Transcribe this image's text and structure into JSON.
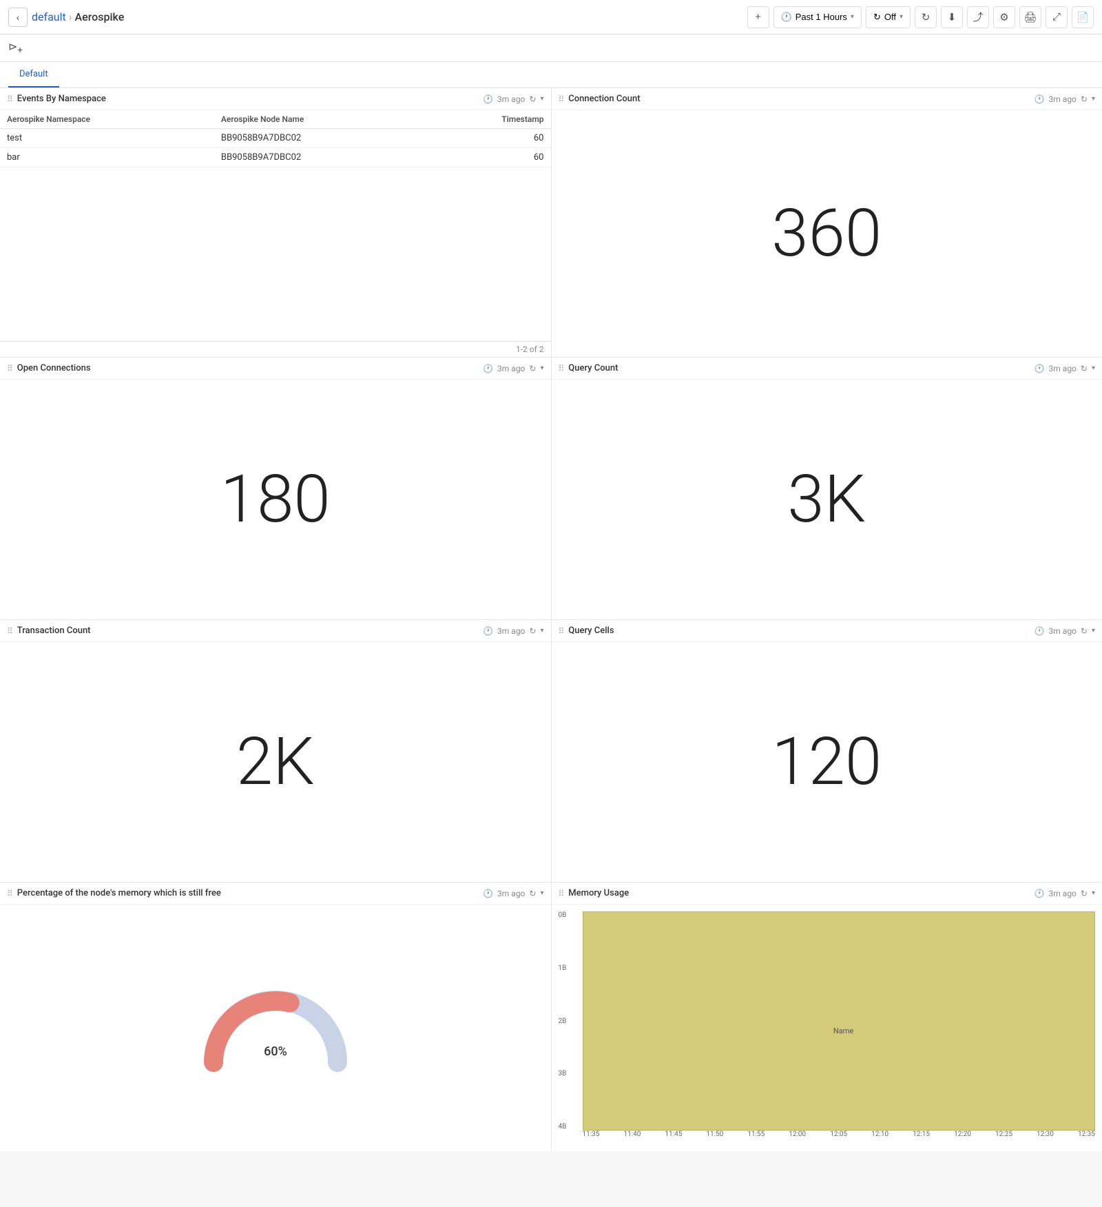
{
  "topbar": {
    "back_label": "‹",
    "breadcrumb_parent": "default",
    "breadcrumb_separator": "›",
    "breadcrumb_current": "Aerospike",
    "add_label": "+",
    "time_icon": "🕐",
    "time_label": "Past 1 Hours",
    "refresh_cycle_icon": "↻",
    "refresh_cycle_label": "Off",
    "refresh_icon": "↻",
    "download_icon": "⬇",
    "share_icon": "⤴",
    "settings_icon": "⚙",
    "print_icon": "🖨",
    "fullscreen_icon": "⤢",
    "docs_icon": "📄"
  },
  "subtoolbar": {
    "filter_icon": "⊳"
  },
  "tabs": [
    {
      "id": "default",
      "label": "Default",
      "active": true
    }
  ],
  "panels": {
    "events_by_namespace": {
      "title": "Events By Namespace",
      "meta_time": "3m ago",
      "columns": [
        "Aerospike Namespace",
        "Aerospike Node Name",
        "Timestamp"
      ],
      "rows": [
        {
          "namespace": "test",
          "node": "BB9058B9A7DBC02",
          "timestamp": "60"
        },
        {
          "namespace": "bar",
          "node": "BB9058B9A7DBC02",
          "timestamp": "60"
        }
      ],
      "footer": "1-2 of 2"
    },
    "connection_count": {
      "title": "Connection Count",
      "meta_time": "3m ago",
      "value": "360"
    },
    "open_connections": {
      "title": "Open Connections",
      "meta_time": "3m ago",
      "value": "180"
    },
    "query_count": {
      "title": "Query Count",
      "meta_time": "3m ago",
      "value": "3K"
    },
    "transaction_count": {
      "title": "Transaction Count",
      "meta_time": "3m ago",
      "value": "2K"
    },
    "query_cells": {
      "title": "Query Cells",
      "meta_time": "3m ago",
      "value": "120"
    },
    "memory_node": {
      "title": "Percentage of the node's memory which is still free",
      "meta_time": "3m ago",
      "gauge_value": "60%",
      "gauge_percent": 60
    },
    "memory_usage": {
      "title": "Memory Usage",
      "meta_time": "3m ago",
      "y_labels": [
        "4B",
        "3B",
        "2B",
        "1B",
        "0B"
      ],
      "y_axis_label": "Name",
      "x_labels": [
        "11:35",
        "11:40",
        "11:45",
        "11:50",
        "11:55",
        "12:00",
        "12:05",
        "12:10",
        "12:15",
        "12:20",
        "12:25",
        "12:30",
        "12:35"
      ]
    }
  },
  "colors": {
    "accent": "#1f60c4",
    "gauge_fill": "#e8837a",
    "gauge_empty": "#c8d3e8",
    "chart_fill": "#d4cc7a",
    "chart_border": "#b8b060"
  }
}
